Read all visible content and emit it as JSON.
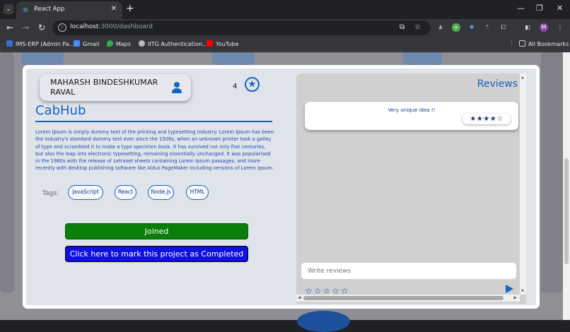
{
  "browser": {
    "tab_title": "React App",
    "url_host": "localhost",
    "url_path": ":3000/dashboard",
    "profile_initial": "M",
    "bookmarks": [
      "IMS-ERP (Admin Pa...",
      "Gmail",
      "Maps",
      "IITG Authentication...",
      "YouTube"
    ],
    "all_bookmarks": "All Bookmarks"
  },
  "project": {
    "owner_name": "MAHARSH BINDESHKUMAR RAVAL",
    "star_count": "4",
    "title": "CabHub",
    "description": "Lorem Ipsum is simply dummy text of the printing and typesetting industry. Lorem Ipsum has been the industry's standard dummy text ever since the 1500s, when an unknown printer took a galley of type and scrambled it to make a type specimen book. It has survived not only five centuries, but also the leap into electronic typesetting, remaining essentially unchanged. It was popularised in the 1960s with the release of Letraset sheets containing Lorem Ipsum passages, and more recently with desktop publishing software like Aldus PageMaker including versions of Lorem Ipsum.",
    "tags_label": "Tags:",
    "tags": [
      "JavaScript",
      "React",
      "Node.js",
      "HTML"
    ],
    "joined_label": "Joined",
    "complete_label": "Click here to mark this project as Completed"
  },
  "reviews": {
    "title": "Reviews",
    "items": [
      {
        "text": "Very unique idea !!",
        "rating": 4,
        "stars_display": "★★★★☆"
      }
    ],
    "input_placeholder": "Write reviews",
    "rating_input_display": "☆☆☆☆☆",
    "rating_input_value": 0
  },
  "colors": {
    "accent": "#1565c0",
    "joined": "#0a7d0a",
    "complete": "#1010e0"
  }
}
